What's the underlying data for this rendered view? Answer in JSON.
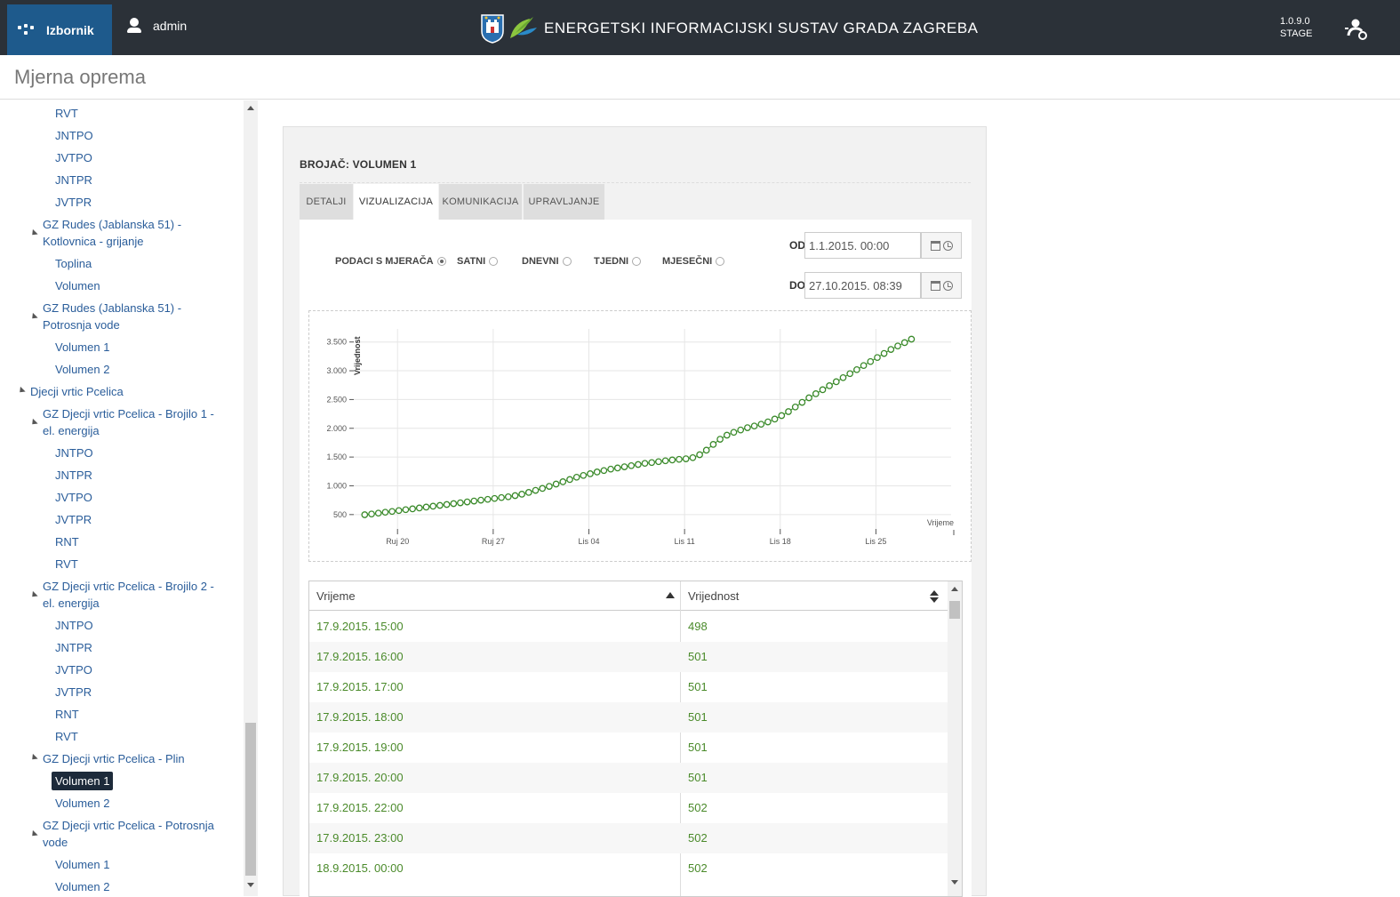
{
  "topbar": {
    "menu_label": "Izbornik",
    "user_name": "admin",
    "app_title": "ENERGETSKI INFORMACIJSKI SUSTAV GRADA ZAGREBA",
    "version": "1.0.9.0",
    "environment": "STAGE",
    "brand_color": "#1e5a8c"
  },
  "page": {
    "title": "Mjerna oprema"
  },
  "sidebar": {
    "items": [
      {
        "label": "RVT"
      },
      {
        "label": "JNTPO"
      },
      {
        "label": "JVTPO"
      },
      {
        "label": "JNTPR"
      },
      {
        "label": "JVTPR"
      },
      {
        "label": "GZ Rudes (Jablanska 51) -"
      },
      {
        "label": "Kotlovnica - grijanje"
      },
      {
        "label": "Toplina"
      },
      {
        "label": "Volumen"
      },
      {
        "label": "GZ Rudes (Jablanska 51) -"
      },
      {
        "label": "Potrosnja vode"
      },
      {
        "label": "Volumen 1"
      },
      {
        "label": "Volumen 2"
      },
      {
        "label": "Djecji vrtic Pcelica"
      },
      {
        "label": "GZ Djecji vrtic Pcelica - Brojilo 1 -"
      },
      {
        "label": "el. energija"
      },
      {
        "label": "JNTPO"
      },
      {
        "label": "JNTPR"
      },
      {
        "label": "JVTPO"
      },
      {
        "label": "JVTPR"
      },
      {
        "label": "RNT"
      },
      {
        "label": "RVT"
      },
      {
        "label": "GZ Djecji vrtic Pcelica - Brojilo 2 -"
      },
      {
        "label": "el. energija"
      },
      {
        "label": "JNTPO"
      },
      {
        "label": "JNTPR"
      },
      {
        "label": "JVTPO"
      },
      {
        "label": "JVTPR"
      },
      {
        "label": "RNT"
      },
      {
        "label": "RVT"
      },
      {
        "label": "GZ Djecji vrtic Pcelica - Plin"
      },
      {
        "label": "Volumen 1"
      },
      {
        "label": "Volumen 2"
      },
      {
        "label": "GZ Djecji vrtic Pcelica - Potrosnja"
      },
      {
        "label": "vode"
      },
      {
        "label": "Volumen 1"
      },
      {
        "label": "Volumen 2"
      }
    ]
  },
  "panel": {
    "meter_title": "BROJAČ: VOLUMEN 1",
    "tabs": [
      {
        "label": "DETALJI"
      },
      {
        "label": "VIZUALIZACIJA"
      },
      {
        "label": "KOMUNIKACIJA"
      },
      {
        "label": "UPRAVLJANJE"
      }
    ],
    "granularity": [
      {
        "label": "PODACI S MJERAČA"
      },
      {
        "label": "SATNI"
      },
      {
        "label": "DNEVNI"
      },
      {
        "label": "TJEDNI"
      },
      {
        "label": "MJESEČNI"
      }
    ],
    "from_label": "OD",
    "from_value": "1.1.2015. 00:00",
    "to_label": "DO",
    "to_value": "27.10.2015. 08:39"
  },
  "chart_data": {
    "type": "line",
    "xlabel": "Vrijeme",
    "ylabel": "Vrijednost",
    "y_ticks": [
      "500",
      "1.000",
      "1.500",
      "2.000",
      "2.500",
      "3.000",
      "3.500"
    ],
    "y_tick_values": [
      500,
      1000,
      1500,
      2000,
      2500,
      3000,
      3500
    ],
    "x_ticks": [
      "Ruj 20",
      "Ruj 27",
      "Lis 04",
      "Lis 11",
      "Lis 18",
      "Lis 25"
    ],
    "x_tick_days": [
      20,
      27,
      34,
      41,
      48,
      55
    ],
    "ylim": [
      250,
      3650
    ],
    "xlim": [
      16.8,
      60.5
    ],
    "series_color": "#3a8a2a",
    "series": [
      {
        "x": [
          17.6,
          18.1,
          18.6,
          19.1,
          19.6,
          20.1,
          20.6,
          21.1,
          21.6,
          22.1,
          22.6,
          23.1,
          23.6,
          24.1,
          24.6,
          25.1,
          25.6,
          26.1,
          26.6,
          27.1,
          27.6,
          28.1,
          28.6,
          29.1,
          29.6,
          30.1,
          30.6,
          31.1,
          31.6,
          32.1,
          32.6,
          33.1,
          33.6,
          34.1,
          34.6,
          35.1,
          35.6,
          36.1,
          36.6,
          37.1,
          37.6,
          38.1,
          38.6,
          39.1,
          39.6,
          40.1,
          40.6,
          41.1,
          41.6,
          42.1,
          42.6,
          43.1,
          43.6,
          44.1,
          44.6,
          45.1,
          45.6,
          46.1,
          46.6,
          47.1,
          47.6,
          48.1,
          48.6,
          49.1,
          49.6,
          50.1,
          50.6,
          51.1,
          51.6,
          52.1,
          52.6,
          53.1,
          53.6,
          54.1,
          54.6,
          55.1,
          55.6,
          56.1,
          56.6,
          57.1,
          57.6
        ],
        "y": [
          498,
          510,
          525,
          540,
          555,
          570,
          585,
          600,
          615,
          630,
          645,
          660,
          675,
          690,
          705,
          720,
          735,
          750,
          765,
          780,
          795,
          810,
          830,
          855,
          885,
          920,
          955,
          990,
          1030,
          1070,
          1110,
          1150,
          1180,
          1210,
          1240,
          1265,
          1290,
          1310,
          1330,
          1350,
          1370,
          1390,
          1405,
          1420,
          1435,
          1450,
          1460,
          1470,
          1490,
          1540,
          1620,
          1720,
          1810,
          1880,
          1930,
          1970,
          2010,
          2040,
          2070,
          2110,
          2160,
          2220,
          2290,
          2370,
          2450,
          2530,
          2600,
          2670,
          2740,
          2810,
          2880,
          2950,
          3020,
          3090,
          3160,
          3230,
          3300,
          3370,
          3430,
          3490,
          3550
        ]
      }
    ]
  },
  "table": {
    "columns": [
      {
        "label": "Vrijeme"
      },
      {
        "label": "Vrijednost"
      }
    ],
    "rows": [
      {
        "time": "17.9.2015. 15:00",
        "value": "498"
      },
      {
        "time": "17.9.2015. 16:00",
        "value": "501"
      },
      {
        "time": "17.9.2015. 17:00",
        "value": "501"
      },
      {
        "time": "17.9.2015. 18:00",
        "value": "501"
      },
      {
        "time": "17.9.2015. 19:00",
        "value": "501"
      },
      {
        "time": "17.9.2015. 20:00",
        "value": "501"
      },
      {
        "time": "17.9.2015. 22:00",
        "value": "502"
      },
      {
        "time": "17.9.2015. 23:00",
        "value": "502"
      },
      {
        "time": "18.9.2015. 00:00",
        "value": "502"
      }
    ]
  }
}
